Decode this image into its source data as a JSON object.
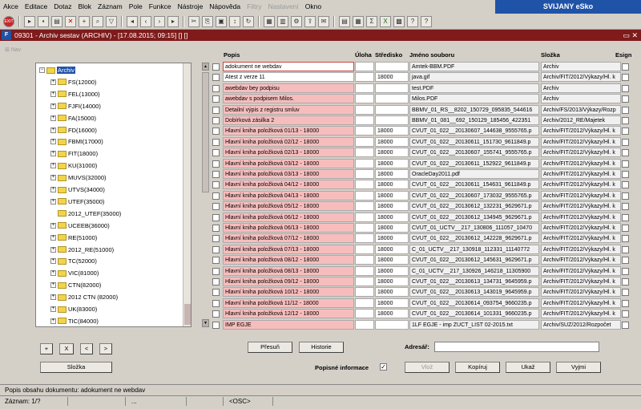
{
  "menu": [
    "Akce",
    "Editace",
    "Dotaz",
    "Blok",
    "Záznam",
    "Pole",
    "Funkce",
    "Nástroje",
    "Nápověda",
    "Filtry",
    "Nastavení",
    "Okno"
  ],
  "menu_disabled": [
    "Filtry",
    "Nastavení"
  ],
  "brand": "SVIJANY eSko",
  "toolbar": {
    "exit_label": "EXIT"
  },
  "window": {
    "icon_label": "F",
    "title": "09301 - Archiv sestav (ARCHIV) - [17.08.2015; 09:15] [] []",
    "controls": "▭ ✕"
  },
  "nav_label": "Nav",
  "tree": {
    "nodes": [
      {
        "label": "Archiv",
        "level": 0,
        "exp": "−",
        "selected": true
      },
      {
        "label": "FS(12000)",
        "level": 1,
        "exp": "+"
      },
      {
        "label": "FEL(13000)",
        "level": 1,
        "exp": "+"
      },
      {
        "label": "FJFI(14000)",
        "level": 1,
        "exp": "+"
      },
      {
        "label": "FA(15000)",
        "level": 1,
        "exp": "+"
      },
      {
        "label": "FD(16000)",
        "level": 1,
        "exp": "+"
      },
      {
        "label": "FBMI(17000)",
        "level": 1,
        "exp": "+"
      },
      {
        "label": "FIT(18000)",
        "level": 1,
        "exp": "+"
      },
      {
        "label": "KU(31000)",
        "level": 1,
        "exp": "+"
      },
      {
        "label": "MUVS(32000)",
        "level": 1,
        "exp": "+"
      },
      {
        "label": "UTVS(34000)",
        "level": 1,
        "exp": "+"
      },
      {
        "label": "UTEF(35000)",
        "level": 1,
        "exp": "+"
      },
      {
        "label": "2012_UTEF(35000)",
        "level": 1,
        "exp": ""
      },
      {
        "label": "UCEEB(36000)",
        "level": 1,
        "exp": "+"
      },
      {
        "label": "RE(51000)",
        "level": 1,
        "exp": "+"
      },
      {
        "label": "2012_RE(51000)",
        "level": 1,
        "exp": "+"
      },
      {
        "label": "TC(52000)",
        "level": 1,
        "exp": "+"
      },
      {
        "label": "VIC(81000)",
        "level": 1,
        "exp": "+"
      },
      {
        "label": "CTN(82000)",
        "level": 1,
        "exp": "+"
      },
      {
        "label": "2012 CTN (82000)",
        "level": 1,
        "exp": "+"
      },
      {
        "label": "UK(83000)",
        "level": 1,
        "exp": "+"
      },
      {
        "label": "TIC(84000)",
        "level": 1,
        "exp": "+"
      }
    ]
  },
  "grid": {
    "headers": {
      "popis": "Popis",
      "uloha": "Úloha",
      "stredisko": "Středisko",
      "jmeno": "Jméno souboru",
      "slozka": "Složka",
      "esign": "Esign"
    },
    "rows": [
      {
        "popis": "adokument ne webdav",
        "uloha": "",
        "stredisko": "",
        "jmeno": "Amtek-BBM.PDF",
        "slozka": "Archiv",
        "active": true,
        "pink": false
      },
      {
        "popis": "Atest z verze 11",
        "uloha": "",
        "stredisko": "18000",
        "jmeno": "java.gif",
        "slozka": "Archiv/FIT/2012/Výkazy/Hl. k",
        "pink": false
      },
      {
        "popis": "awebdav bey podpisu",
        "uloha": "",
        "stredisko": "",
        "jmeno": "test.PDF",
        "slozka": "Archiv",
        "pink": true
      },
      {
        "popis": "awebdav s podpisem Milos.",
        "uloha": "",
        "stredisko": "",
        "jmeno": "Milos.PDF",
        "slozka": "Archiv",
        "pink": true
      },
      {
        "popis": "Detailní výpis z registru smluv",
        "uloha": "",
        "stredisko": "",
        "jmeno": "BBMV_01_RS__8202_150729_095835_544616",
        "slozka": "Archiv/FS/2013/Výkazy/Rozp",
        "pink": true
      },
      {
        "popis": "Dobírková zásilka 2",
        "uloha": "",
        "stredisko": "",
        "jmeno": "BBMV_01_081__692_150129_185456_422351",
        "slozka": "Archiv/2012_RE/Majetek",
        "pink": true
      },
      {
        "popis": "Hlavní kniha položková 01/13 - 18000",
        "uloha": "",
        "stredisko": "18000",
        "jmeno": "CVUT_01_022__20130607_144638_9555765.p",
        "slozka": "Archiv/FIT/2012/Výkazy/Hl. k",
        "pink": true
      },
      {
        "popis": "Hlavní kniha položková 02/12 - 18000",
        "uloha": "",
        "stredisko": "18000",
        "jmeno": "CVUT_01_022__20130611_151730_9611849.p",
        "slozka": "Archiv/FIT/2012/Výkazy/Hl. k",
        "pink": true
      },
      {
        "popis": "Hlavní kniha položková 02/13 - 18000",
        "uloha": "",
        "stredisko": "18000",
        "jmeno": "CVUT_01_022__20130607_155741_9555765.p",
        "slozka": "Archiv/FIT/2012/Výkazy/Hl. k",
        "pink": true
      },
      {
        "popis": "Hlavní kniha položková 03/12 - 18000",
        "uloha": "",
        "stredisko": "18000",
        "jmeno": "CVUT_01_022__20130611_152922_9611849.p",
        "slozka": "Archiv/FIT/2012/Výkazy/Hl. k",
        "pink": true
      },
      {
        "popis": "Hlavní kniha položková 03/13 - 18000",
        "uloha": "",
        "stredisko": "18000",
        "jmeno": "OracleDay2011.pdf",
        "slozka": "Archiv/FIT/2012/Výkazy/Hl. k",
        "pink": true
      },
      {
        "popis": "Hlavní kniha položková 04/12 - 18000",
        "uloha": "",
        "stredisko": "18000",
        "jmeno": "CVUT_01_022__20130611_154631_9611849.p",
        "slozka": "Archiv/FIT/2012/Výkazy/Hl. k",
        "pink": true
      },
      {
        "popis": "Hlavní kniha položková 04/13 - 18000",
        "uloha": "",
        "stredisko": "18000",
        "jmeno": "CVUT_01_022__20130607_173032_9555765.p",
        "slozka": "Archiv/FIT/2012/Výkazy/Hl. k",
        "pink": true
      },
      {
        "popis": "Hlavní kniha položková 05/12 - 18000",
        "uloha": "",
        "stredisko": "18000",
        "jmeno": "CVUT_01_022__20130612_132231_9629671.p",
        "slozka": "Archiv/FIT/2012/Výkazy/Hl. k",
        "pink": true
      },
      {
        "popis": "Hlavní kniha položková 06/12 - 18000",
        "uloha": "",
        "stredisko": "18000",
        "jmeno": "CVUT_01_022__20130612_134945_9629671.p",
        "slozka": "Archiv/FIT/2012/Výkazy/Hl. k",
        "pink": true
      },
      {
        "popis": "Hlavní kniha položková 06/13 - 18000",
        "uloha": "",
        "stredisko": "18000",
        "jmeno": "CVUT_01_UCTV__217_130806_111057_10470",
        "slozka": "Archiv/FIT/2012/Výkazy/Hl. k",
        "pink": true
      },
      {
        "popis": "Hlavní kniha položková 07/12 - 18000",
        "uloha": "",
        "stredisko": "18000",
        "jmeno": "CVUT_01_022__20130612_142228_9629671.p",
        "slozka": "Archiv/FIT/2012/Výkazy/Hl. k",
        "pink": true
      },
      {
        "popis": "Hlavní kniha položková 07/13 - 18000",
        "uloha": "",
        "stredisko": "18000",
        "jmeno": "C_01_UCTV__217_130918_112331_11140772",
        "slozka": "Archiv/FIT/2012/Výkazy/Hl. k",
        "pink": true
      },
      {
        "popis": "Hlavní kniha položková 08/12 - 18000",
        "uloha": "",
        "stredisko": "18000",
        "jmeno": "CVUT_01_022__20130612_145631_9629671.p",
        "slozka": "Archiv/FIT/2012/Výkazy/Hl. k",
        "pink": true
      },
      {
        "popis": "Hlavní kniha položková 08/13 - 18000",
        "uloha": "",
        "stredisko": "18000",
        "jmeno": "C_01_UCTV__217_130926_146218_11305900",
        "slozka": "Archiv/FIT/2012/Výkazy/Hl. k",
        "pink": true
      },
      {
        "popis": "Hlavní kniha položková 09/12 - 18000",
        "uloha": "",
        "stredisko": "18000",
        "jmeno": "CVUT_01_022__20130613_134731_9645959.p",
        "slozka": "Archiv/FIT/2012/Výkazy/Hl. k",
        "pink": true
      },
      {
        "popis": "Hlavní kniha položková 10/12 - 18000",
        "uloha": "",
        "stredisko": "18000",
        "jmeno": "CVUT_01_022__20130613_143019_9645959.p",
        "slozka": "Archiv/FIT/2012/Výkazy/Hl. k",
        "pink": true
      },
      {
        "popis": "Hlavní kniha položková 11/12 - 18000",
        "uloha": "",
        "stredisko": "18000",
        "jmeno": "CVUT_01_022__20130614_093754_9660235.p",
        "slozka": "Archiv/FIT/2012/Výkazy/Hl. k",
        "pink": true
      },
      {
        "popis": "Hlavní kniha položková 12/12 - 18000",
        "uloha": "",
        "stredisko": "18000",
        "jmeno": "CVUT_01_022__20130614_101331_9660235.p",
        "slozka": "Archiv/FIT/2012/Výkazy/Hl. k",
        "pink": true
      },
      {
        "popis": "IMP EGJE",
        "uloha": "",
        "stredisko": "",
        "jmeno": "1LF EGJE - imp ZUCT_LIST 02-2015.txt",
        "slozka": "Archiv/SUZ/2012/Rozpočet",
        "pink": true
      }
    ]
  },
  "tree_buttons": {
    "add": "+",
    "remove": "X",
    "prev": "<",
    "next": ">",
    "slozka": "Složka"
  },
  "mid_buttons": {
    "presun": "Přesuň",
    "historie": "Historie"
  },
  "adresar_label": "Adresář:",
  "popisne_label": "Popisné informace",
  "popisne_check": "✓",
  "action_buttons": {
    "vloz": "Vlož",
    "kopiruj": "Kopíruj",
    "ukaz": "Ukaž",
    "vyjmi": "Vyjmi"
  },
  "status": {
    "line1": "Popis obsahu dokumentu: adokument ne webdav",
    "zaznam": "Záznam: 1/?",
    "dots": "...",
    "osc": "<OSC>"
  }
}
